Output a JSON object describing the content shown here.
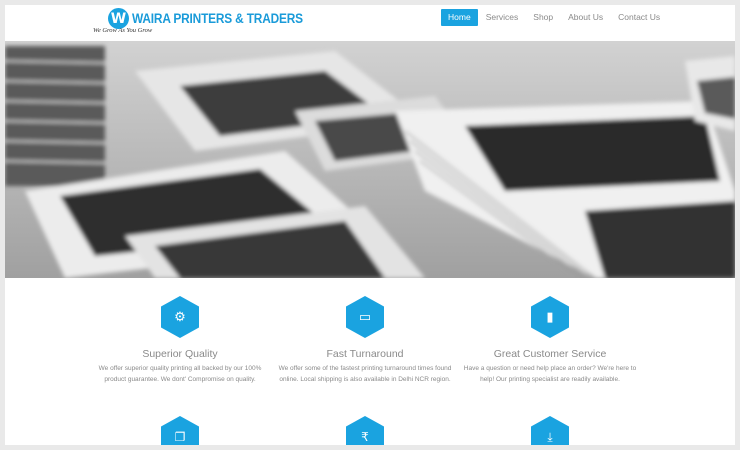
{
  "brand": {
    "mark": "W",
    "name": "WAIRA PRINTERS & TRADERS",
    "tagline": "We Grow As You Grow"
  },
  "nav": {
    "items": [
      {
        "label": "Home",
        "active": true
      },
      {
        "label": "Services",
        "active": false
      },
      {
        "label": "Shop",
        "active": false
      },
      {
        "label": "About Us",
        "active": false
      },
      {
        "label": "Contact Us",
        "active": false
      }
    ]
  },
  "colors": {
    "accent": "#1aa3e0",
    "text_muted": "#8a8a8a"
  },
  "features": [
    {
      "icon": "gears-icon",
      "title": "Superior Quality",
      "text": "We offer superior quality printing all backed by our 100% product guarantee. We dont' Compromise on quality."
    },
    {
      "icon": "monitor-icon",
      "title": "Fast Turnaround",
      "text": "We offer some of the fastest printing turnaround times found online. Local shipping is also available in Delhi NCR region."
    },
    {
      "icon": "book-icon",
      "title": "Great Customer Service",
      "text": "Have a question or need help place an order? We're here to help! Our printing specialist are readily available."
    }
  ],
  "second_row_icons": [
    "copy-icon",
    "rupee-icon",
    "download-icon"
  ]
}
